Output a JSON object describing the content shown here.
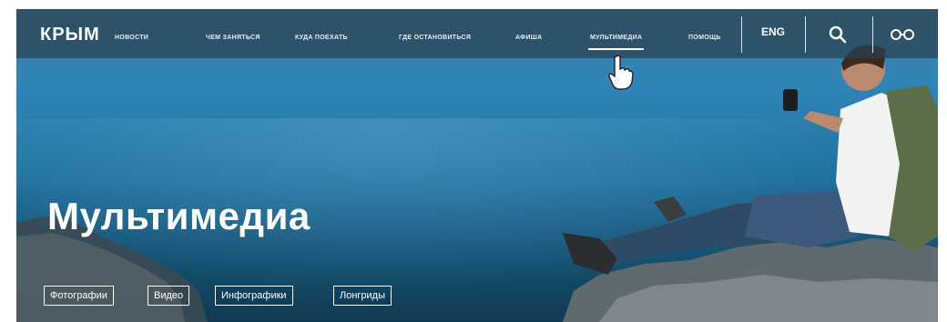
{
  "header": {
    "logo": "КРЫМ",
    "menu": [
      {
        "label": "НОВОСТИ"
      },
      {
        "label": "ЧЕМ ЗАНЯТЬСЯ"
      },
      {
        "label": "КУДА ПОЕХАТЬ"
      },
      {
        "label": "ГДЕ ОСТАНОВИТЬСЯ"
      },
      {
        "label": "АФИША"
      },
      {
        "label": "МУЛЬТИМЕДИА"
      },
      {
        "label": "ПОМОЩЬ"
      }
    ],
    "active_item": "МУЛЬТИМЕДИА",
    "language": "ENG",
    "icons": [
      "search-icon",
      "accessibility-glasses-icon"
    ]
  },
  "hero": {
    "title": "Мультимедиа",
    "tabs": [
      {
        "label": "Фотографии"
      },
      {
        "label": "Видео"
      },
      {
        "label": "Инфографики"
      },
      {
        "label": "Лонгриды"
      }
    ]
  },
  "colors": {
    "nav_overlay": "#28414f",
    "sea_top": "#2f84b7",
    "sea_bottom": "#0f3a52",
    "text": "#ffffff"
  }
}
